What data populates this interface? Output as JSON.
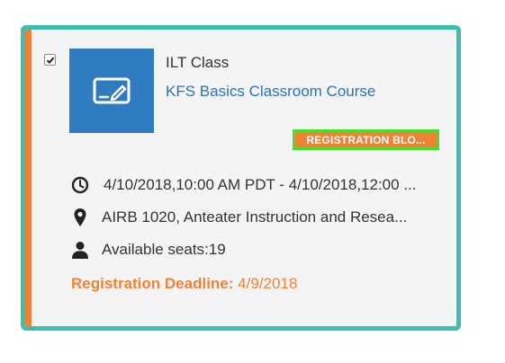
{
  "card": {
    "selected": true,
    "course_type": "ILT Class",
    "course_title": "KFS Basics Classroom Course",
    "status_badge": "REGISTRATION BLO...",
    "date_range": "4/10/2018,10:00 AM PDT - 4/10/2018,12:00 ...",
    "location": "AIRB 1020, Anteater Instruction and Resea...",
    "seats": "Available seats:19",
    "deadline_label": "Registration Deadline:",
    "deadline_value": "4/9/2018"
  },
  "icons": {
    "thumbnail": "classroom-whiteboard-icon",
    "date": "clock-icon",
    "location": "map-pin-icon",
    "seats": "user-icon",
    "checkbox": "checkmark-icon"
  },
  "colors": {
    "card_border": "#3cbfae",
    "accent_stripe": "#f08236",
    "thumbnail_bg": "#2f7bbf",
    "link": "#2f70b5",
    "badge_bg": "#f08236",
    "badge_outline": "#46e02c",
    "deadline": "#f08236"
  }
}
